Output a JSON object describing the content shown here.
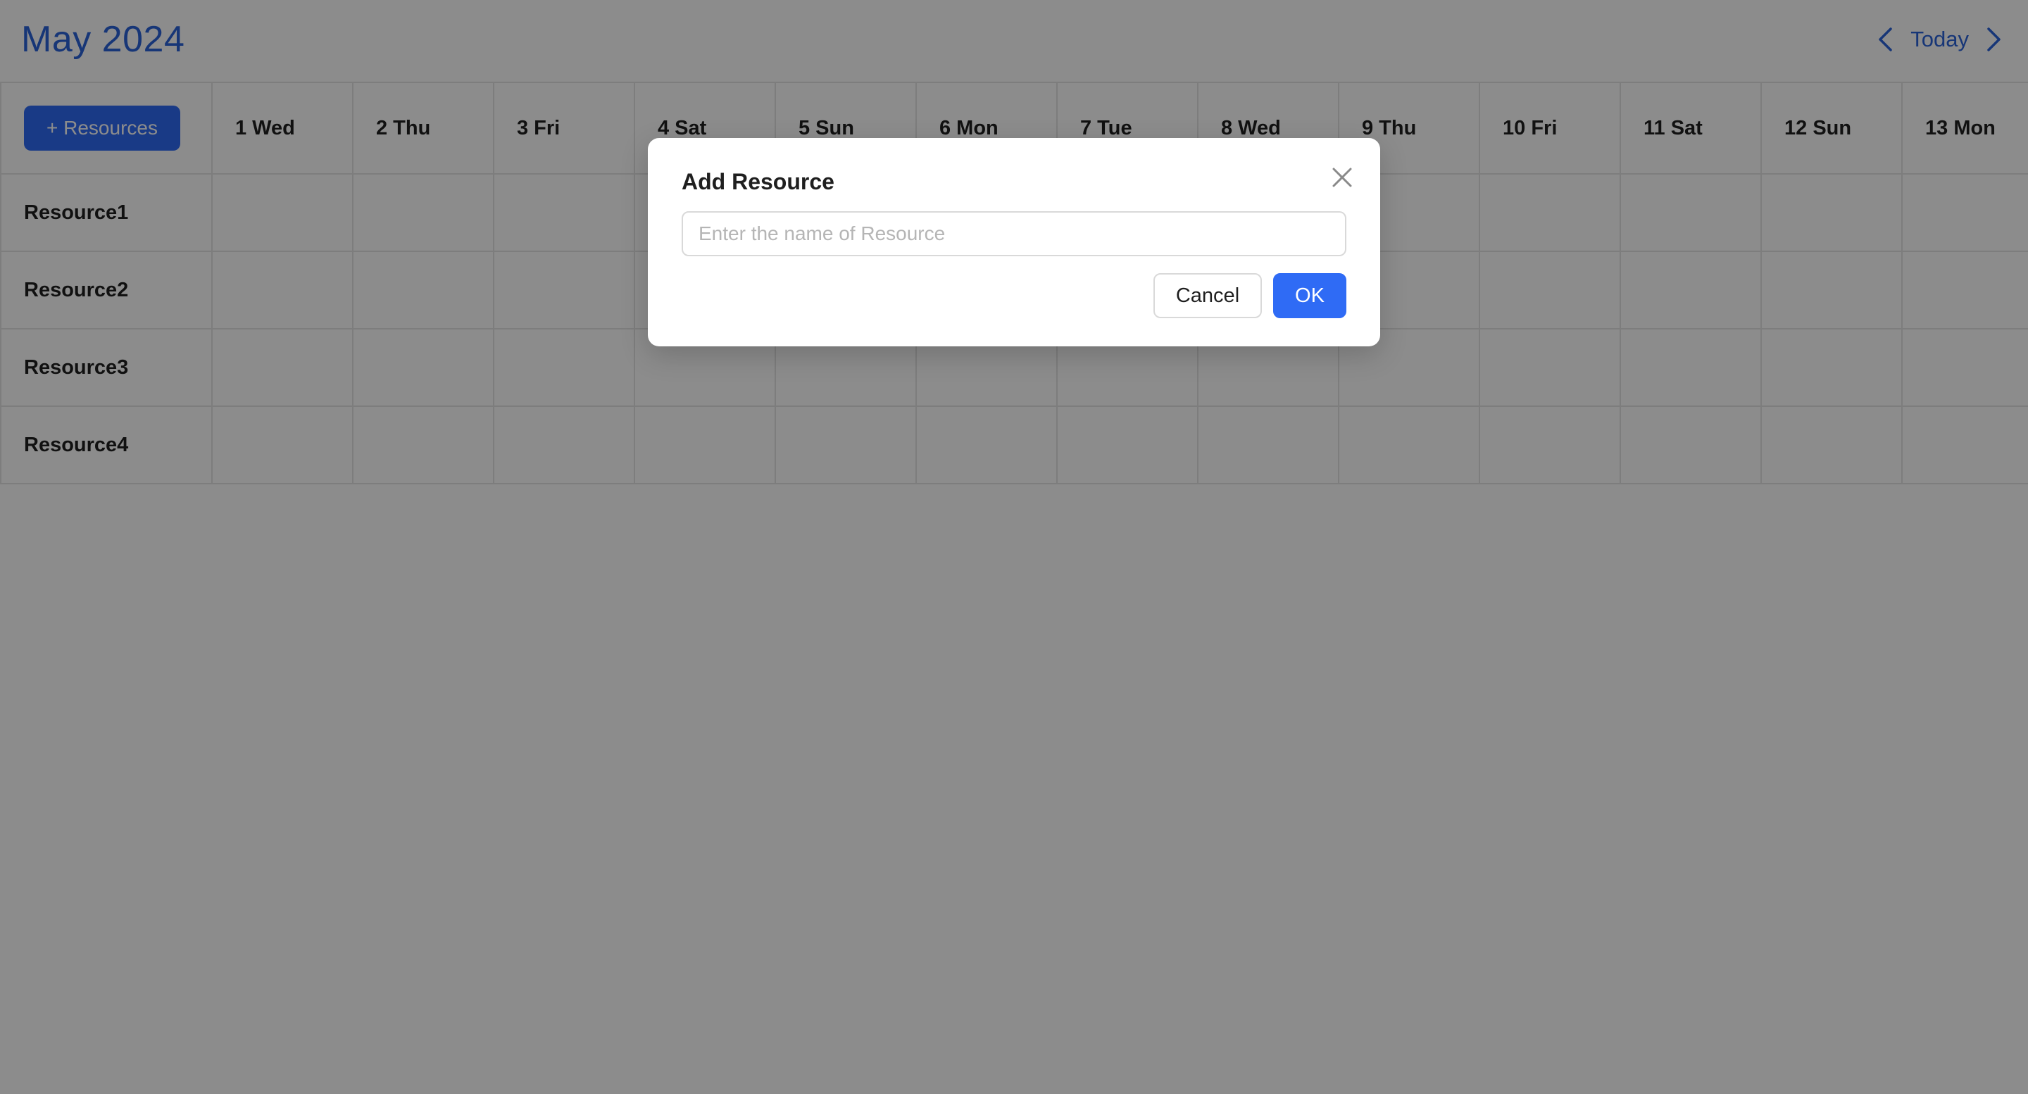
{
  "header": {
    "month_title": "May 2024",
    "prev_icon": "chevron-left-icon",
    "today_label": "Today",
    "next_icon": "chevron-right-icon"
  },
  "scheduler": {
    "add_resources_label": "+ Resources",
    "days": [
      "1 Wed",
      "2 Thu",
      "3 Fri",
      "4 Sat",
      "5 Sun",
      "6 Mon",
      "7 Tue",
      "8 Wed",
      "9 Thu",
      "10 Fri",
      "11 Sat",
      "12 Sun",
      "13 Mon"
    ],
    "resources": [
      "Resource1",
      "Resource2",
      "Resource3",
      "Resource4"
    ]
  },
  "modal": {
    "title": "Add Resource",
    "close_icon": "close-icon",
    "input_placeholder": "Enter the name of Resource",
    "input_value": "",
    "cancel_label": "Cancel",
    "ok_label": "OK"
  },
  "colors": {
    "accent": "#2f6bf5",
    "title_blue": "#2b63d9",
    "overlay": "rgba(0,0,0,0.45)"
  }
}
